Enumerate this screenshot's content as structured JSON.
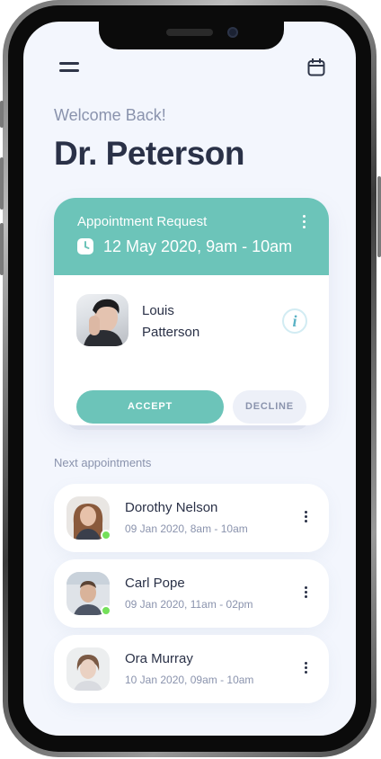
{
  "header": {
    "menu_icon": "menu-icon",
    "calendar_icon": "calendar-icon",
    "welcome": "Welcome Back!",
    "doctor_name": "Dr. Peterson"
  },
  "request": {
    "title": "Appointment Request",
    "date": "12 May 2020, 9am - 10am",
    "patient_first": "Louis",
    "patient_last": "Patterson",
    "info_glyph": "i",
    "accept_label": "ACCEPT",
    "decline_label": "DECLINE"
  },
  "next": {
    "title": "Next appointments",
    "items": [
      {
        "name": "Dorothy Nelson",
        "time": "09 Jan 2020, 8am - 10am",
        "online": true
      },
      {
        "name": "Carl Pope",
        "time": "09 Jan 2020, 11am - 02pm",
        "online": true
      },
      {
        "name": "Ora Murray",
        "time": "10 Jan 2020, 09am - 10am",
        "online": false
      }
    ]
  },
  "colors": {
    "accent": "#6cc4b9",
    "background": "#f3f6fd",
    "text_dark": "#2a3147",
    "text_muted": "#8a93ad",
    "online": "#74e05a"
  }
}
